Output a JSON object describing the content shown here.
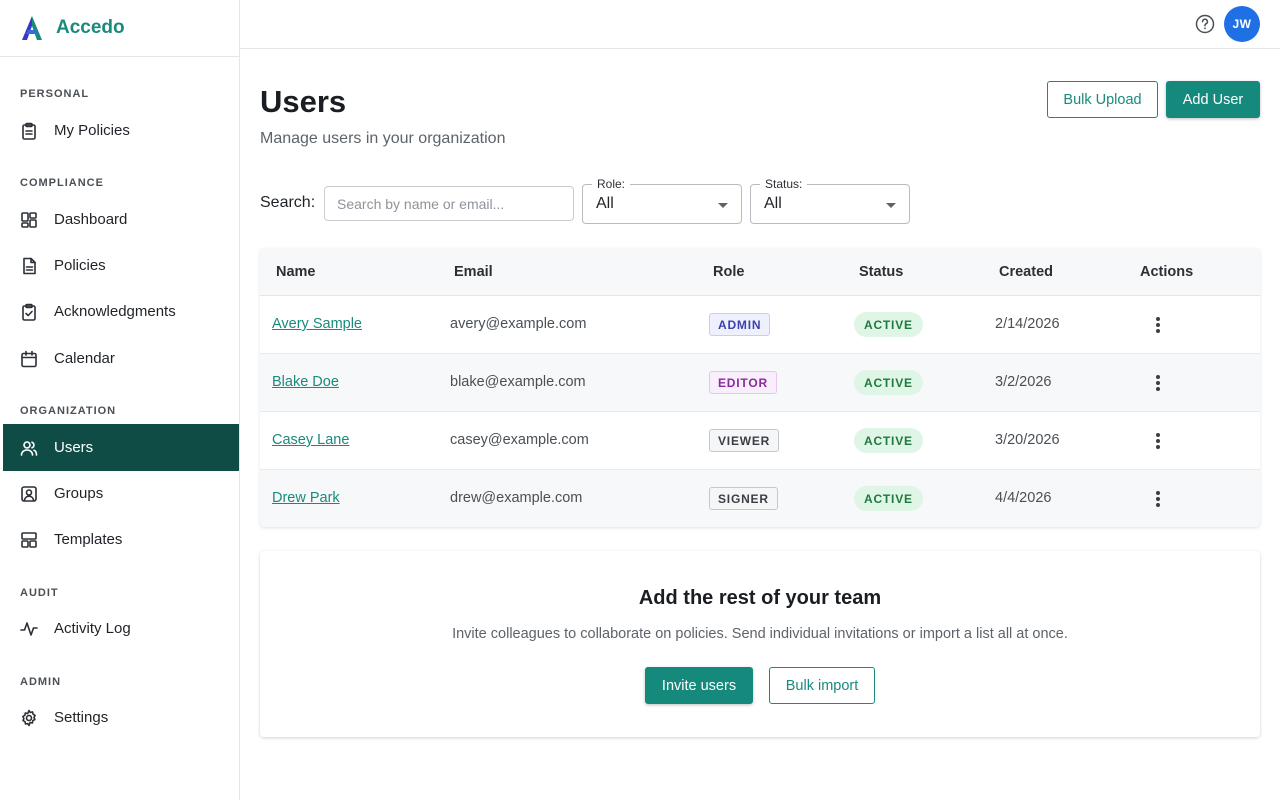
{
  "brand": {
    "name": "Accedo"
  },
  "sidebar": {
    "sections": [
      {
        "label": "PERSONAL"
      },
      {
        "label": "COMPLIANCE"
      },
      {
        "label": "ORGANIZATION"
      },
      {
        "label": "AUDIT"
      },
      {
        "label": "ADMIN"
      }
    ],
    "items": [
      {
        "label": "My Policies",
        "icon": "clipboard-icon"
      },
      {
        "label": "Dashboard",
        "icon": "dashboard-icon"
      },
      {
        "label": "Policies",
        "icon": "document-icon"
      },
      {
        "label": "Acknowledgments",
        "icon": "clipboard-check-icon"
      },
      {
        "label": "Calendar",
        "icon": "calendar-icon"
      },
      {
        "label": "Users",
        "icon": "users-icon",
        "active": true
      },
      {
        "label": "Groups",
        "icon": "group-icon"
      },
      {
        "label": "Templates",
        "icon": "template-icon"
      },
      {
        "label": "Activity Log",
        "icon": "activity-icon"
      },
      {
        "label": "Settings",
        "icon": "gear-icon"
      }
    ]
  },
  "header": {
    "avatar_initials": "JW"
  },
  "page": {
    "title": "Users",
    "subtitle": "Manage users in your organization",
    "bulk_upload_label": "Bulk Upload",
    "add_user_label": "Add User"
  },
  "filters": {
    "search_label": "Search:",
    "search_placeholder": "Search by name or email...",
    "search_value": "",
    "role_label": "Role:",
    "role_value": "All",
    "status_label": "Status:",
    "status_value": "All"
  },
  "table": {
    "headers": [
      "Name",
      "Email",
      "Role",
      "Status",
      "Created",
      "Actions"
    ],
    "rows": [
      {
        "name": "Avery Sample",
        "email": "avery@example.com",
        "role": "ADMIN",
        "status": "ACTIVE",
        "created": "2/14/2026"
      },
      {
        "name": "Blake Doe",
        "email": "blake@example.com",
        "role": "EDITOR",
        "status": "ACTIVE",
        "created": "3/2/2026"
      },
      {
        "name": "Casey Lane",
        "email": "casey@example.com",
        "role": "VIEWER",
        "status": "ACTIVE",
        "created": "3/20/2026"
      },
      {
        "name": "Drew Park",
        "email": "drew@example.com",
        "role": "SIGNER",
        "status": "ACTIVE",
        "created": "4/4/2026"
      }
    ]
  },
  "invite": {
    "title": "Add the rest of your team",
    "description": "Invite colleagues to collaborate on policies. Send individual invitations or import a list all at once.",
    "invite_button": "Invite users",
    "import_button": "Bulk import"
  },
  "colors": {
    "brand": "#1a8a7d",
    "active_nav": "#0f4c45",
    "primary_button": "#15897c",
    "avatar": "#1f6fe5",
    "role_admin_bg": "#eef0fd",
    "role_admin_text": "#3b3fb0",
    "role_editor_bg": "#f9effc",
    "role_editor_text": "#8a2a9e",
    "role_neutral_bg": "#f5f6f7",
    "role_neutral_text": "#3a3f45",
    "status_active_bg": "#dff5e6",
    "status_active_text": "#1e7a3d"
  }
}
